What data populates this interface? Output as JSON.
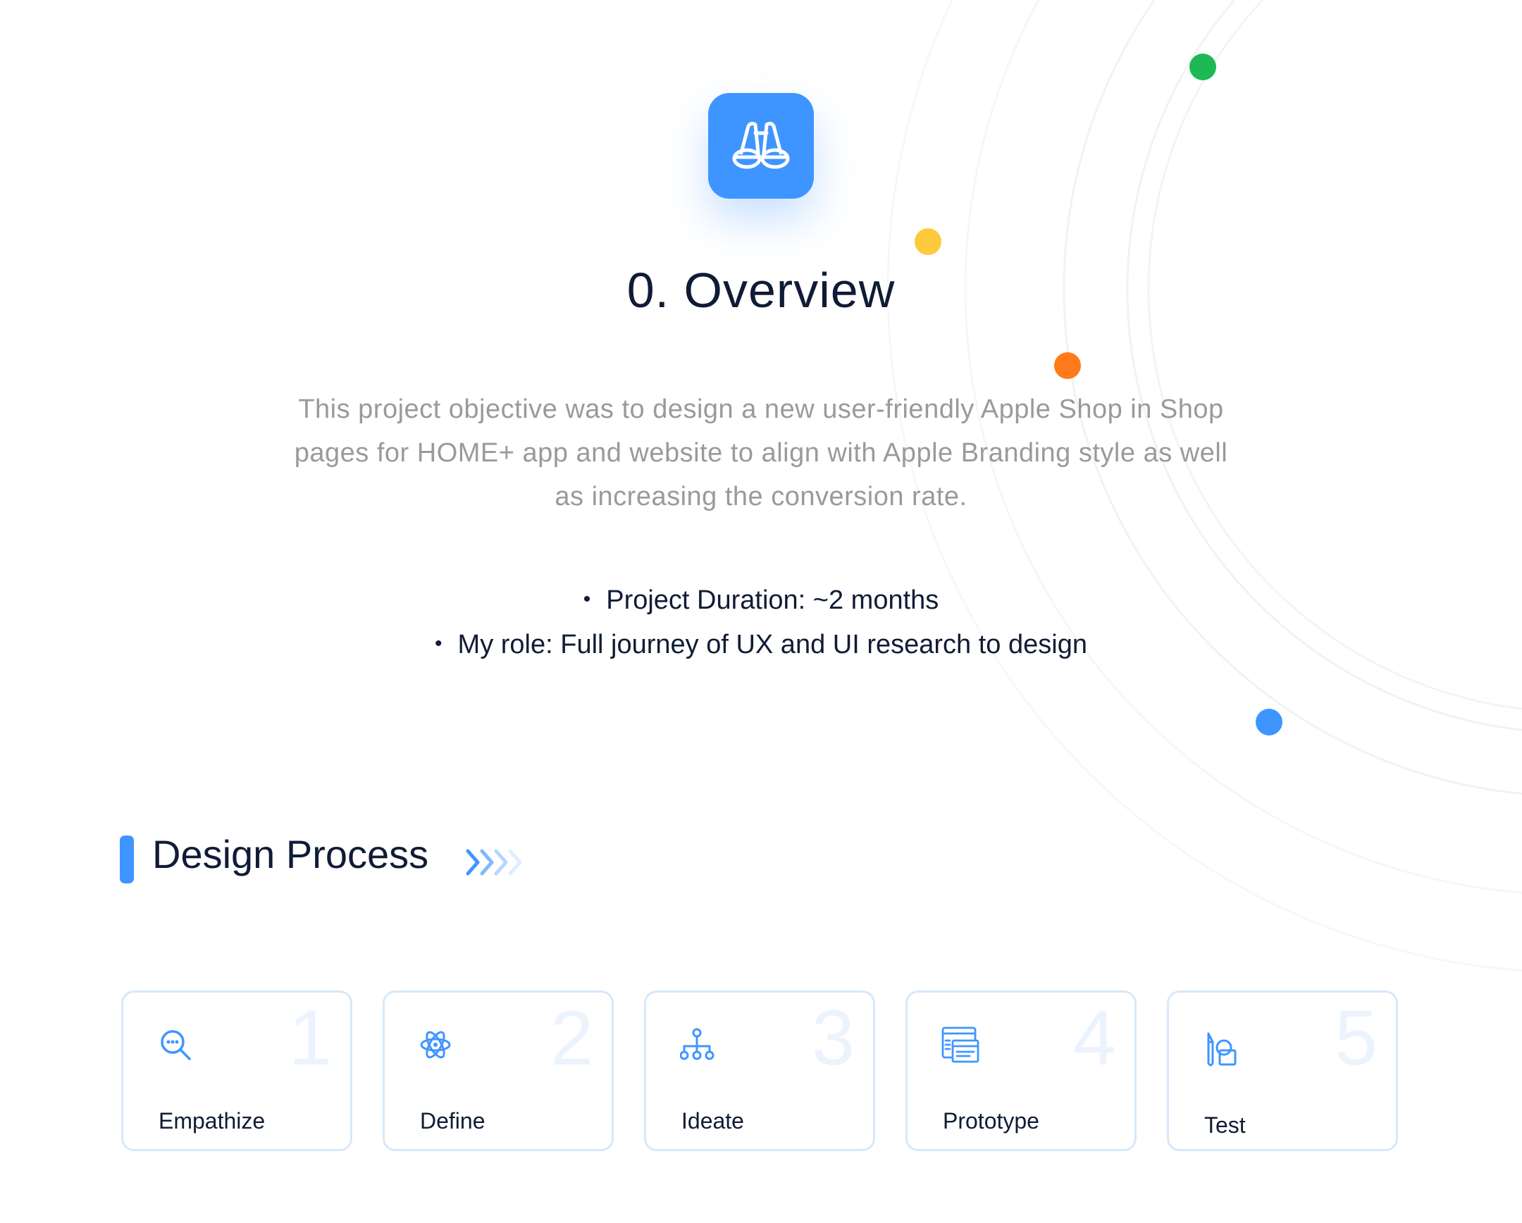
{
  "header": {
    "icon": "binoculars-icon",
    "title": "0. Overview"
  },
  "overview": {
    "description_lines": [
      "This project objective was to design a new user-friendly Apple Shop in Shop",
      "pages for HOME+ app and website to align with Apple Branding style as well",
      "as increasing the conversion rate."
    ],
    "bullets": [
      "Project Duration: ~2 months",
      "My role: Full journey of UX and UI research to design"
    ]
  },
  "design_process": {
    "title": "Design Process",
    "steps": [
      {
        "number": "1",
        "label": "Empathize",
        "icon": "search-chat-icon"
      },
      {
        "number": "2",
        "label": "Define",
        "icon": "react-atom-icon"
      },
      {
        "number": "3",
        "label": "Ideate",
        "icon": "hierarchy-icon"
      },
      {
        "number": "4",
        "label": "Prototype",
        "icon": "browser-layout-icon"
      },
      {
        "number": "5",
        "label": "Test",
        "icon": "pen-shapes-icon"
      }
    ]
  },
  "colors": {
    "accent_blue": "#3f95ff",
    "dot_green": "#1db954",
    "dot_yellow": "#ffc83d",
    "dot_orange": "#ff7a1a",
    "dot_blue": "#3f95ff",
    "text_dark": "#101c35",
    "text_gray": "#9a9a9a",
    "card_border": "#d6e8fb"
  }
}
